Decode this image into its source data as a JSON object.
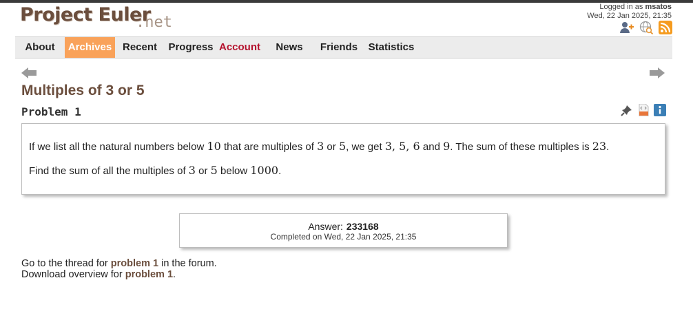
{
  "logo": {
    "main": "Project Euler",
    "suffix": ".net"
  },
  "login": {
    "prefix": "Logged in as",
    "username": "msatos",
    "datetime": "Wed, 22 Jan 2025, 21:35"
  },
  "top_icons": [
    "add-friend-icon",
    "search-globe-icon",
    "rss-icon"
  ],
  "nav": {
    "items": [
      {
        "label": "About"
      },
      {
        "label": "Archives",
        "active": true
      },
      {
        "label": "Recent"
      },
      {
        "label": "Progress"
      },
      {
        "label": "Account"
      },
      {
        "label": "News"
      },
      {
        "label": "Friends"
      },
      {
        "label": "Statistics"
      }
    ],
    "active_color": "#f9a25a",
    "account_color": "#b5122e"
  },
  "problem": {
    "title": "Multiples of 3 or 5",
    "number_label": "Problem 1",
    "icons": [
      "pin-icon",
      "code-file-icon",
      "info-icon"
    ],
    "para1": {
      "t1": "If we list all the natural numbers below ",
      "m1": "10",
      "t2": " that are multiples of ",
      "m2": "3",
      "t3": " or ",
      "m3": "5",
      "t4": ", we get ",
      "m4": "3, 5, 6",
      "t5": " and ",
      "m5": "9",
      "t6": ". The sum of these multiples is ",
      "m6": "23",
      "t7": "."
    },
    "para2": {
      "t1": "Find the sum of all the multiples of ",
      "m1": "3",
      "t2": " or ",
      "m2": "5",
      "t3": " below ",
      "m3": "1000",
      "t4": "."
    }
  },
  "answer": {
    "label": "Answer:",
    "value": "233168",
    "completed": "Completed on Wed, 22 Jan 2025, 21:35"
  },
  "footer": {
    "line1_prefix": "Go to the thread for ",
    "line1_link": "problem 1",
    "line1_suffix": " in the forum.",
    "line2_prefix": "Download overview for ",
    "line2_link": "problem 1",
    "line2_suffix": "."
  },
  "colors": {
    "title": "#6b4e3d",
    "link": "#6b4e3d"
  }
}
